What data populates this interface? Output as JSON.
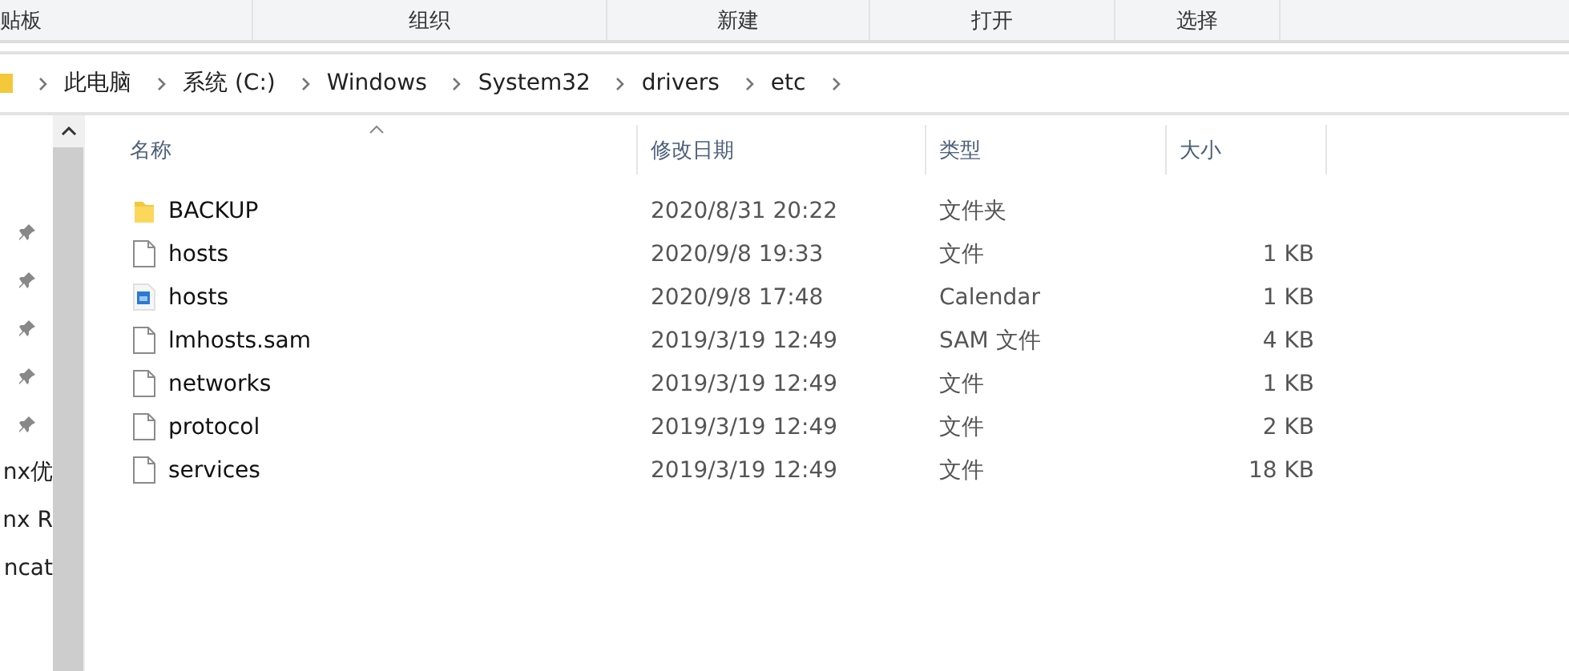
{
  "ribbon_groups": [
    {
      "label": "贴板"
    },
    {
      "label": "组织"
    },
    {
      "label": "新建"
    },
    {
      "label": "打开"
    },
    {
      "label": "选择"
    }
  ],
  "breadcrumb": [
    "此电脑",
    "系统 (C:)",
    "Windows",
    "System32",
    "drivers",
    "etc"
  ],
  "quick_access": [
    {
      "kind": "pinned"
    },
    {
      "kind": "pinned"
    },
    {
      "kind": "pinned"
    },
    {
      "kind": "pinned"
    },
    {
      "kind": "pinned"
    },
    {
      "kind": "text",
      "label": "nx优"
    },
    {
      "kind": "text",
      "label": "nx R"
    },
    {
      "kind": "text",
      "label": "ncat"
    }
  ],
  "columns": [
    "名称",
    "修改日期",
    "类型",
    "大小"
  ],
  "files": [
    {
      "kind": "folder",
      "name": "BACKUP",
      "modified": "2020/8/31 20:22",
      "type": "文件夹"
    },
    {
      "kind": "file",
      "name": "hosts",
      "modified": "2020/9/8 19:33",
      "type": "文件",
      "size": "1 KB"
    },
    {
      "kind": "calendar",
      "name": "hosts",
      "modified": "2020/9/8 17:48",
      "type": "Calendar",
      "size": "1 KB"
    },
    {
      "kind": "file",
      "name": "lmhosts.sam",
      "modified": "2019/3/19 12:49",
      "type": "SAM 文件",
      "size": "4 KB"
    },
    {
      "kind": "file",
      "name": "networks",
      "modified": "2019/3/19 12:49",
      "type": "文件",
      "size": "1 KB"
    },
    {
      "kind": "file",
      "name": "protocol",
      "modified": "2019/3/19 12:49",
      "type": "文件",
      "size": "2 KB"
    },
    {
      "kind": "file",
      "name": "services",
      "modified": "2019/3/19 12:49",
      "type": "文件",
      "size": "18 KB"
    }
  ]
}
